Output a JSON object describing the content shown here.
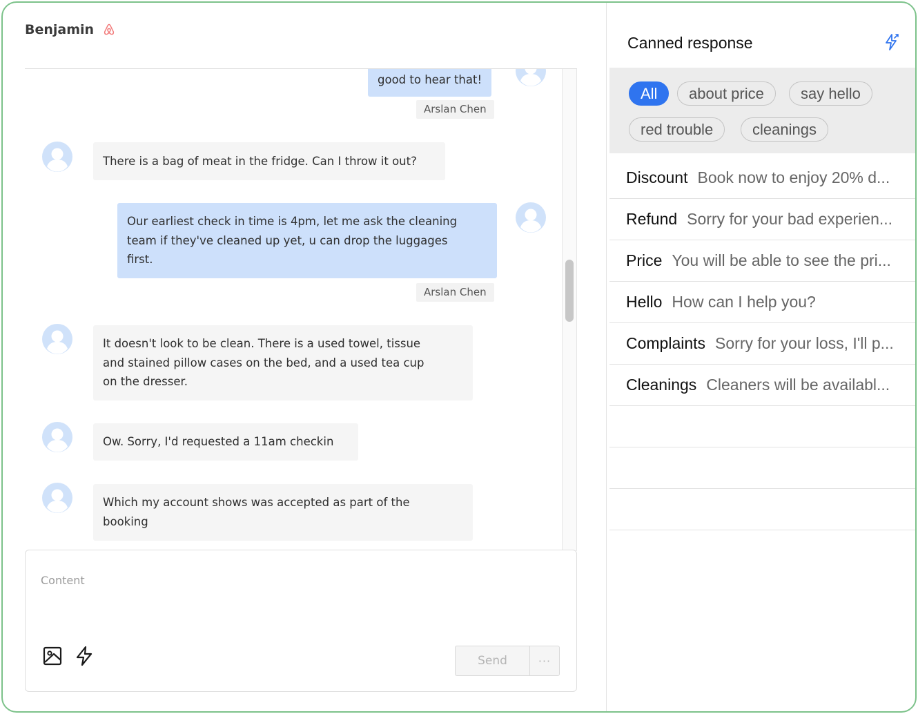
{
  "chat": {
    "guest_name": "Benjamin",
    "messages": [
      {
        "direction": "out",
        "text": "good to hear that!",
        "sender": "Arslan Chen"
      },
      {
        "direction": "in",
        "text": "There is a bag of meat in the fridge. Can I throw it out?"
      },
      {
        "direction": "out",
        "lines": [
          "Our earliest check in time is 4pm, let me ask the cleaning",
          "team if they've cleaned up yet, u can drop the luggages",
          "first."
        ],
        "sender": "Arslan Chen"
      },
      {
        "direction": "in",
        "lines": [
          "It doesn't look to be clean. There is a used towel, tissue",
          "and stained pillow cases on the bed, and a used tea cup",
          "on the dresser."
        ]
      },
      {
        "direction": "in",
        "text": "Ow. Sorry, I'd requested a 11am checkin"
      },
      {
        "direction": "in",
        "lines": [
          "Which my account shows was accepted as part of the",
          "booking"
        ]
      }
    ],
    "composer": {
      "placeholder": "Content",
      "send_label": "Send",
      "more_label": "···"
    }
  },
  "canned": {
    "title": "Canned response",
    "tags": [
      "All",
      "about price",
      "say hello",
      "red trouble",
      "cleanings"
    ],
    "active_tag": "All",
    "responses": [
      {
        "name": "Discount",
        "preview": "Book now to enjoy 20% d..."
      },
      {
        "name": "Refund",
        "preview": "Sorry for your bad experien..."
      },
      {
        "name": "Price",
        "preview": "You will be able to see the pri..."
      },
      {
        "name": "Hello",
        "preview": "How can I help you?"
      },
      {
        "name": "Complaints",
        "preview": "Sorry for your loss, I'll p..."
      },
      {
        "name": "Cleanings",
        "preview": "Cleaners will be availabl..."
      }
    ]
  },
  "colors": {
    "frame_border": "#7cc28a",
    "accent_blue": "#2f74ef",
    "outgoing_bubble": "#cde0fb",
    "incoming_bubble": "#f5f5f5",
    "avatar": "#d0e2fa",
    "airbnb": "#f27a7a"
  },
  "icons": {
    "platform": "airbnb-icon",
    "avatar": "user-avatar-icon",
    "image": "image-icon",
    "quick_reply": "lightning-icon",
    "canned_edit": "lightning-edit-icon"
  }
}
